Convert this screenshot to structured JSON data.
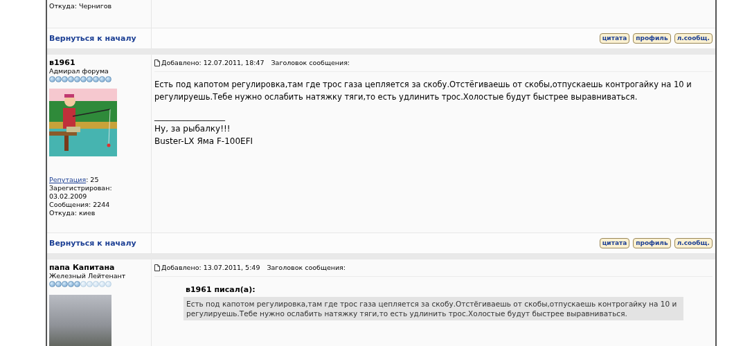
{
  "posts": [
    {
      "kind": "partial",
      "location": "Откуда: Чернигов",
      "footer": {
        "back_link": "Вернуться к началу",
        "buttons": [
          "цитата",
          "профиль",
          "л.сообщ."
        ]
      }
    },
    {
      "kind": "full",
      "author": "в1961",
      "rank": "Адмирал форума",
      "stars": 10,
      "avatar": {
        "kind": "drawing"
      },
      "reputation_label": "Репутация",
      "reputation_value": ": 25",
      "registered": "Зарегистрирован: 03.02.2009",
      "messages": "Сообщения: 2244",
      "location": "Откуда: киев",
      "posted": "Добавлено: 12.07.2011, 18:47",
      "subject_label": "Заголовок сообщения:",
      "body": "Есть под капотом регулировка,там где трос газа цепляется за скобу.Отстёгиваешь от скобы,отпускаешь контрогайку на 10 и регулируешь.Тебе нужно ослабить натяжку тяги,то есть удлинить трос.Холостые будут быстрее выравниваться.",
      "signature": [
        "_________________",
        "Ну, за рыбалку!!!",
        "Buster-LX Яма F-100EFI"
      ],
      "footer": {
        "back_link": "Вернуться к началу",
        "buttons": [
          "цитата",
          "профиль",
          "л.сообщ."
        ]
      }
    },
    {
      "kind": "full",
      "author": "папа Капитана",
      "rank": "Железный Лейтенант",
      "stars": 5,
      "avatar": {
        "kind": "photo"
      },
      "posted": "Добавлено: 13.07.2011, 5:49",
      "subject_label": "Заголовок сообщения:",
      "quote": {
        "author": "в1961 писал(а):",
        "text": "Есть под капотом регулировка,там где трос газа цепляется за скобу.Отстёгиваешь от скобы,отпускаешь контрогайку на 10 и регулируешь.Тебе нужно ослабить натяжку тяги,то есть удлинить трос.Холостые будут быстрее выравниваться."
      }
    }
  ]
}
